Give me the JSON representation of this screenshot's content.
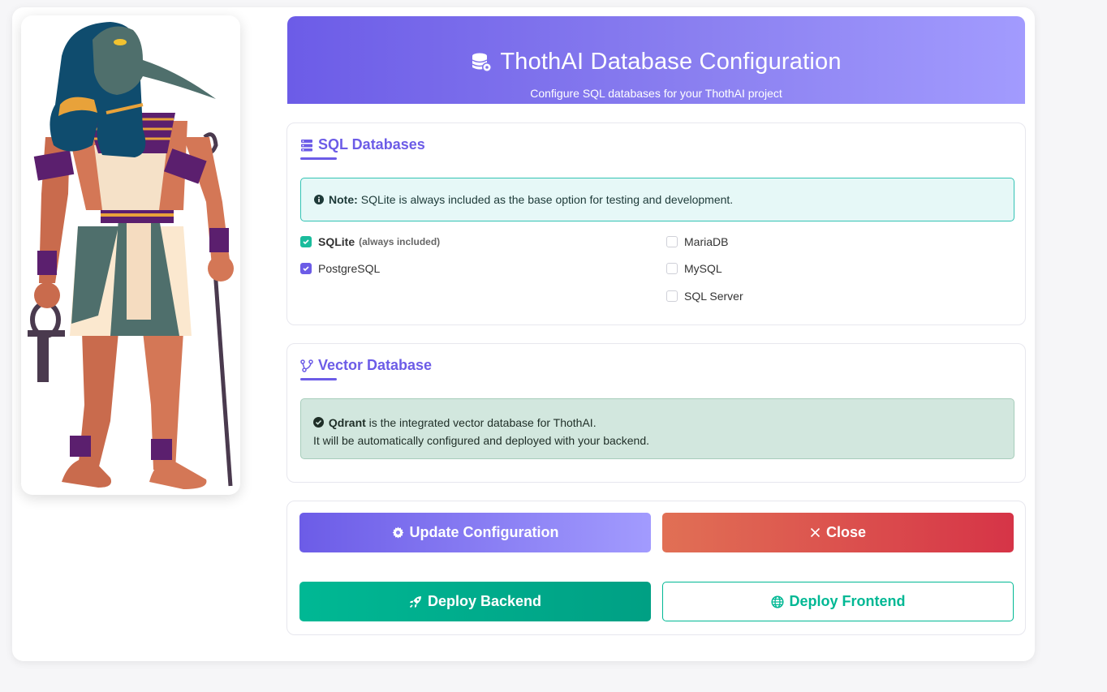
{
  "header": {
    "icon": "database-gear-icon",
    "title": "ThothAI Database Configuration",
    "subtitle": "Configure SQL databases for your ThothAI project"
  },
  "sql_section": {
    "icon": "server-icon",
    "title": "SQL Databases",
    "note_label": "Note:",
    "note_text": "SQLite is always included as the base option for testing and development.",
    "options": [
      {
        "label": "SQLite",
        "suffix": "(always included)",
        "checked": true
      },
      {
        "label": "PostgreSQL",
        "checked": true
      },
      {
        "label": "MariaDB",
        "checked": false
      },
      {
        "label": "MySQL",
        "checked": false
      },
      {
        "label": "SQL Server",
        "checked": false
      }
    ]
  },
  "vector_section": {
    "icon": "vector-branch-icon",
    "title": "Vector Database",
    "name": "Qdrant",
    "line1_rest": "is the integrated vector database for ThothAI.",
    "line2": "It will be automatically configured and deployed with your backend."
  },
  "actions": {
    "update_label": "Update Configuration",
    "close_label": "Close",
    "deploy_backend_label": "Deploy Backend",
    "deploy_frontend_label": "Deploy Frontend"
  },
  "colors": {
    "accent": "#6c5ce7",
    "accent_light": "#a29bfe",
    "teal": "#00b894",
    "danger": "#d63447",
    "danger_start": "#e17055"
  }
}
